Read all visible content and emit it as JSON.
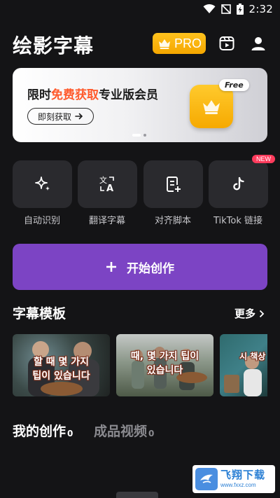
{
  "status_bar": {
    "time": "2:32"
  },
  "header": {
    "title": "绘影字幕",
    "pro_label": "PRO"
  },
  "banner": {
    "title_prefix": "限时",
    "title_highlight": "免费获取",
    "title_suffix": "专业版会员",
    "button_label": "即刻获取",
    "free_tag": "Free",
    "page_count": 2,
    "active_page": 1
  },
  "tools": [
    {
      "label": "自动识别",
      "icon": "sparkle-icon"
    },
    {
      "label": "翻译字幕",
      "icon": "translate-icon"
    },
    {
      "label": "对齐脚本",
      "icon": "document-add-icon"
    },
    {
      "label": "TikTok 链接",
      "icon": "tiktok-icon"
    }
  ],
  "new_badge": "NEW",
  "create_button": {
    "label": "开始创作"
  },
  "templates_section": {
    "title": "字幕模板",
    "more_label": "更多",
    "cards": [
      {
        "caption_line1": "할 때 몇 가지",
        "caption_line2": "팁이 있습니다"
      },
      {
        "caption_line1": "때, 몇 가지 팁이",
        "caption_line2": "있습니다"
      },
      {
        "caption_line1": "시 책상",
        "caption_line2": ""
      }
    ]
  },
  "works_tabs": [
    {
      "label": "我的创作",
      "count": "0"
    },
    {
      "label": "成品视频",
      "count": "0"
    }
  ],
  "watermark": {
    "main": "飞翔下载",
    "url": "www.fxxz.com"
  },
  "colors": {
    "background": "#141416",
    "accent_purple": "#7c44c4",
    "pro_gold": "#ffc21d",
    "highlight_orange": "#ff5a2c",
    "new_red": "#ff3b5c"
  }
}
